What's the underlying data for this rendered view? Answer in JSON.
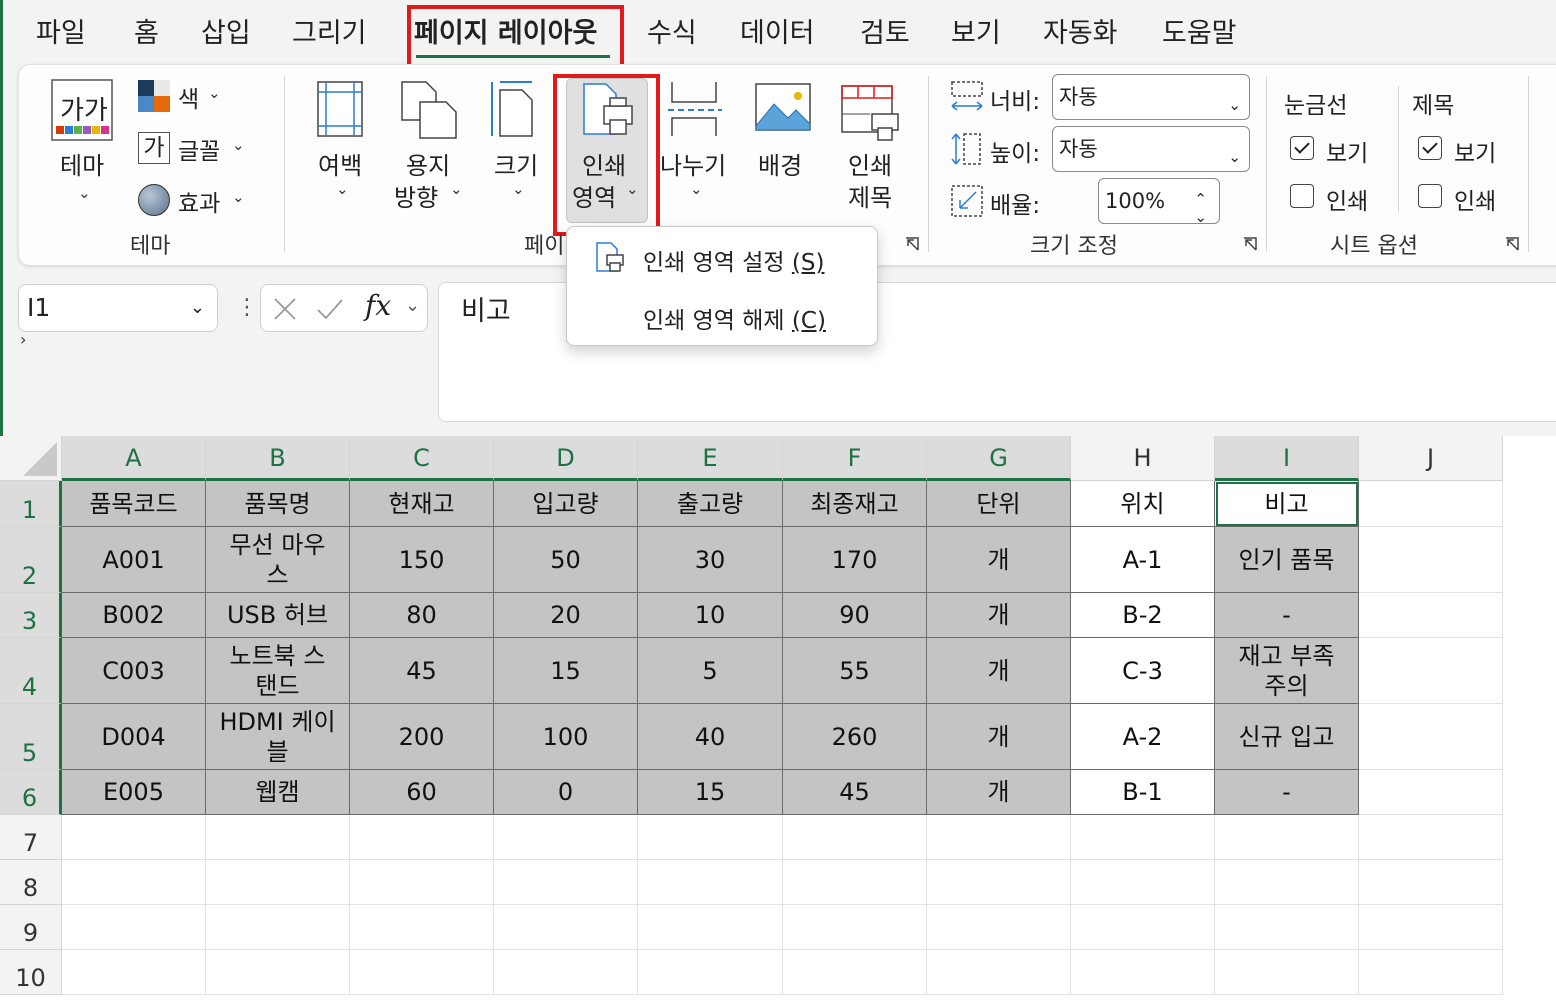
{
  "menu": [
    {
      "label": "파일",
      "active": false
    },
    {
      "label": "홈",
      "active": false
    },
    {
      "label": "삽입",
      "active": false
    },
    {
      "label": "그리기",
      "active": false
    },
    {
      "label": "페이지 레이아웃",
      "active": true
    },
    {
      "label": "수식",
      "active": false
    },
    {
      "label": "데이터",
      "active": false
    },
    {
      "label": "검토",
      "active": false
    },
    {
      "label": "보기",
      "active": false
    },
    {
      "label": "자동화",
      "active": false
    },
    {
      "label": "도움말",
      "active": false
    }
  ],
  "ribbon": {
    "themes_group": {
      "theme_button": "테마",
      "theme_icon_text": "가가",
      "colors": "색",
      "fonts_icon_text": "가",
      "fonts": "글꼴",
      "effects": "효과",
      "group_label": "테마"
    },
    "page_setup_group": {
      "margins": "여백",
      "orientation_line1": "용지",
      "orientation_line2": "방향",
      "size": "크기",
      "print_area_line1": "인쇄",
      "print_area_line2": "영역",
      "breaks": "나누기",
      "background": "배경",
      "print_titles_line1": "인쇄",
      "print_titles_line2": "제목",
      "group_label": "페이"
    },
    "scale_group": {
      "width_label": "너비:",
      "width_value": "자동",
      "height_label": "높이:",
      "height_value": "자동",
      "scale_label": "배율:",
      "scale_value": "100%",
      "group_label": "크기 조정"
    },
    "sheet_options_group": {
      "gridlines": "눈금선",
      "headings": "제목",
      "view": "보기",
      "print": "인쇄",
      "gridlines_view_checked": true,
      "gridlines_print_checked": false,
      "headings_view_checked": true,
      "headings_print_checked": false,
      "group_label": "시트 옵션"
    }
  },
  "dropdown": {
    "set_print_area": "인쇄 영역 설정",
    "set_print_area_key": "(S)",
    "clear_print_area": "인쇄 영역 해제",
    "clear_print_area_key": "(C)"
  },
  "formula_bar": {
    "name_box": "I1",
    "fx": "fx",
    "content": "비고"
  },
  "sheet": {
    "columns": [
      "A",
      "B",
      "C",
      "D",
      "E",
      "F",
      "G",
      "H",
      "I",
      "J"
    ],
    "rows": [
      "1",
      "2",
      "3",
      "4",
      "5",
      "6",
      "7",
      "8",
      "9",
      "10"
    ],
    "cells": [
      [
        "품목코드",
        "품목명",
        "현재고",
        "입고량",
        "출고량",
        "최종재고",
        "단위",
        "위치",
        "비고"
      ],
      [
        "A001",
        "무선 마우\n스",
        "150",
        "50",
        "30",
        "170",
        "개",
        "A-1",
        "인기 품목"
      ],
      [
        "B002",
        "USB 허브",
        "80",
        "20",
        "10",
        "90",
        "개",
        "B-2",
        "-"
      ],
      [
        "C003",
        "노트북 스\n탠드",
        "45",
        "15",
        "5",
        "55",
        "개",
        "C-3",
        "재고 부족\n주의"
      ],
      [
        "D004",
        "HDMI 케이\n블",
        "200",
        "100",
        "40",
        "260",
        "개",
        "A-2",
        "신규 입고"
      ],
      [
        "E005",
        "웹캠",
        "60",
        "0",
        "15",
        "45",
        "개",
        "B-1",
        "-"
      ]
    ]
  },
  "colors": {
    "excel_green": "#1e7145",
    "highlight_red": "#e01b1b",
    "selection_fill": "#c4c4c4"
  }
}
